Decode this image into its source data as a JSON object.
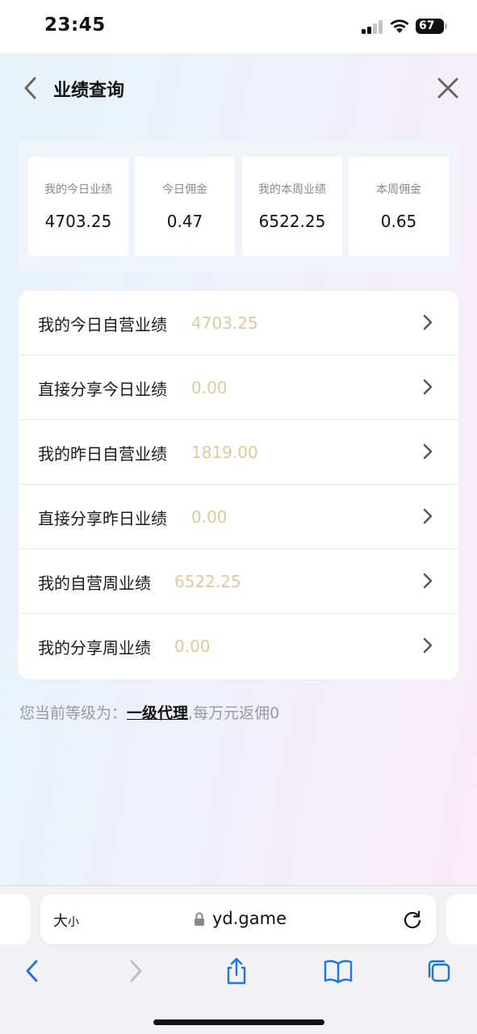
{
  "status_bar": {
    "time": "23:45",
    "battery": "67"
  },
  "header": {
    "title": "业绩查询"
  },
  "summary": [
    {
      "label": "我的今日业绩",
      "value": "4703.25"
    },
    {
      "label": "今日佣金",
      "value": "0.47"
    },
    {
      "label": "我的本周业绩",
      "value": "6522.25"
    },
    {
      "label": "本周佣金",
      "value": "0.65"
    }
  ],
  "list": [
    {
      "label": "我的今日自营业绩",
      "value": "4703.25"
    },
    {
      "label": "直接分享今日业绩",
      "value": "0.00"
    },
    {
      "label": "我的昨日自营业绩",
      "value": "1819.00"
    },
    {
      "label": "直接分享昨日业绩",
      "value": "0.00"
    },
    {
      "label": "我的自营周业绩",
      "value": "6522.25"
    },
    {
      "label": "我的分享周业绩",
      "value": "0.00"
    }
  ],
  "level": {
    "prefix": "您当前等级为：",
    "link": "一级代理",
    "suffix": ",每万元返佣0"
  },
  "browser": {
    "text_size_big": "大",
    "text_size_small": "小",
    "url": "yd.game"
  },
  "colors": {
    "value_gold": "#dccb9a",
    "toolbar_blue": "#1a73e8"
  }
}
